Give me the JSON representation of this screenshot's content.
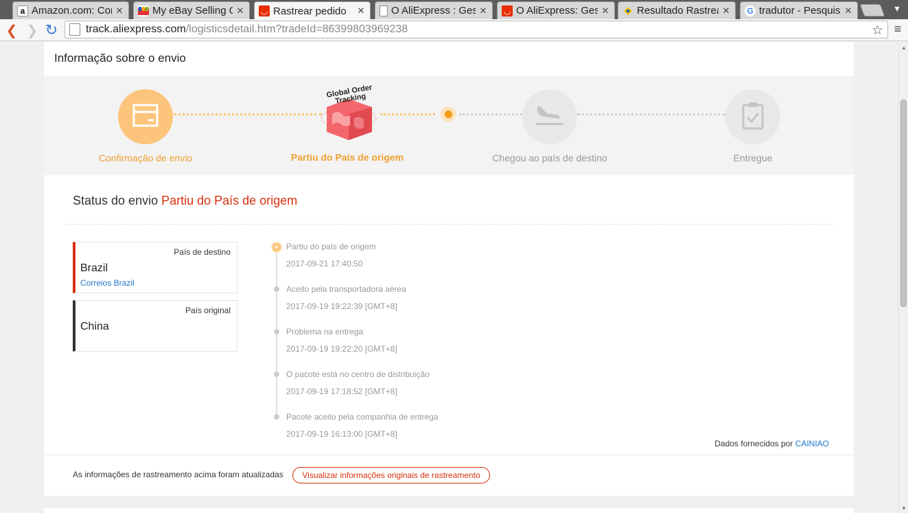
{
  "browser": {
    "tabs": [
      {
        "title": "Amazon.com: Con",
        "icon": "amazon-icon",
        "active": false
      },
      {
        "title": "My eBay Selling O",
        "icon": "ebay-icon",
        "active": false
      },
      {
        "title": "Rastrear pedido",
        "icon": "aliexpress-icon",
        "active": true
      },
      {
        "title": "O AliExpress : Ges",
        "icon": "page-icon",
        "active": false
      },
      {
        "title": "O AliExpress: Gest",
        "icon": "aliexpress-icon",
        "active": false
      },
      {
        "title": "Resultado Rastrea",
        "icon": "tracking-icon",
        "active": false
      },
      {
        "title": "tradutor - Pesquis",
        "icon": "google-icon",
        "active": false
      }
    ],
    "url_host": "track.aliexpress.com",
    "url_path": "/logisticsdetail.htm?tradeId=86399803969238"
  },
  "page": {
    "card_title": "Informação sobre o envio",
    "steps": [
      {
        "label": "Confirmação de envio",
        "state": "done",
        "icon": "box-icon"
      },
      {
        "label": "Partiu do País de origem",
        "state": "current",
        "icon": "globe-icon",
        "badge": "Global Order Tracking"
      },
      {
        "label": "Chegou ao país de destino",
        "state": "pending",
        "icon": "plane-landing-icon"
      },
      {
        "label": "Entregue",
        "state": "pending",
        "icon": "clipboard-check-icon"
      }
    ],
    "status_label": "Status do envio",
    "status_value": "Partiu do País de origem",
    "destination": {
      "kind": "País de destino",
      "country": "Brazil",
      "carrier": "Correios Brazil"
    },
    "origin": {
      "kind": "País original",
      "country": "China"
    },
    "events": [
      {
        "desc": "Partiu do país de origem",
        "time": "2017-09-21 17:40:50"
      },
      {
        "desc": "Aceito pela transportadora aérea",
        "time": "2017-09-19 19:22:39 [GMT+8]"
      },
      {
        "desc": "Problema na entrega",
        "time": "2017-09-19 19:22:20 [GMT+8]"
      },
      {
        "desc": "O pacote está no centro de distribuição",
        "time": "2017-09-19 17:18:52 [GMT+8]"
      },
      {
        "desc": "Pacote aceito pela companhia de entrega",
        "time": "2017-09-19 16:13:00 [GMT+8]"
      }
    ],
    "provider_label": "Dados fornecidos por",
    "provider_name": "CAINIAO",
    "footer_note": "As informações de rastreamento acima foram atualizadas",
    "original_button": "Visualizar informações originais de rastreamento"
  },
  "colors": {
    "accent_orange": "#f5a623",
    "accent_red": "#d6300e",
    "link_blue": "#1e74c8",
    "pending_grey": "#e8e8e8"
  }
}
